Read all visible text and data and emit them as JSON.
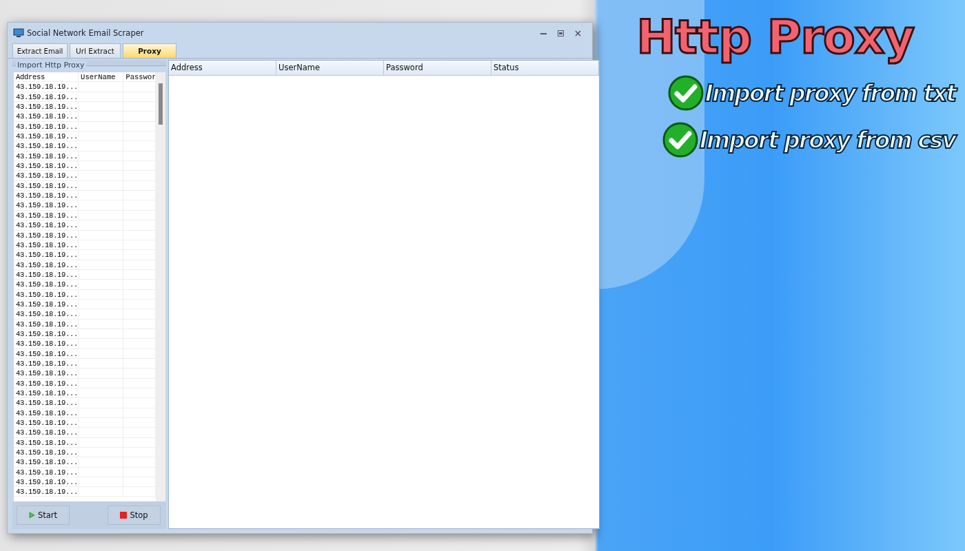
{
  "window": {
    "title": "Social Network Email Scraper"
  },
  "tabs": [
    {
      "label": "Extract Email",
      "selected": false
    },
    {
      "label": "Url Extract",
      "selected": false
    },
    {
      "label": "Proxy",
      "selected": true
    }
  ],
  "import_panel": {
    "title": "Import Http Proxy",
    "columns": [
      "Address",
      "UserName",
      "Passwor"
    ],
    "rows": [
      "43.159.18.19...",
      "43.159.18.19...",
      "43.159.18.19...",
      "43.159.18.19...",
      "43.159.18.19...",
      "43.159.18.19...",
      "43.159.18.19...",
      "43.159.18.19...",
      "43.159.18.19...",
      "43.159.18.19...",
      "43.159.18.19...",
      "43.159.18.19...",
      "43.159.18.19...",
      "43.159.18.19...",
      "43.159.18.19...",
      "43.159.18.19...",
      "43.159.18.19...",
      "43.159.18.19...",
      "43.159.18.19...",
      "43.159.18.19...",
      "43.159.18.19...",
      "43.159.18.19...",
      "43.159.18.19...",
      "43.159.18.19...",
      "43.159.18.19...",
      "43.159.18.19...",
      "43.159.18.19...",
      "43.159.18.19...",
      "43.159.18.19...",
      "43.159.18.19...",
      "43.159.18.19...",
      "43.159.18.19...",
      "43.159.18.19...",
      "43.159.18.19...",
      "43.159.18.19...",
      "43.159.18.19...",
      "43.159.18.19...",
      "43.159.18.19...",
      "43.159.18.19...",
      "43.159.18.19...",
      "43.159.18.19...",
      "43.159.18.19..."
    ]
  },
  "buttons": [
    {
      "label": "Start",
      "kind": "start"
    },
    {
      "label": "Stop",
      "kind": "stop"
    }
  ],
  "result_table": {
    "columns": [
      "Address",
      "UserName",
      "Password",
      "Status"
    ]
  },
  "promo": {
    "headline": "Http Proxy",
    "features": [
      "Import proxy from txt",
      "Import proxy from csv"
    ]
  }
}
